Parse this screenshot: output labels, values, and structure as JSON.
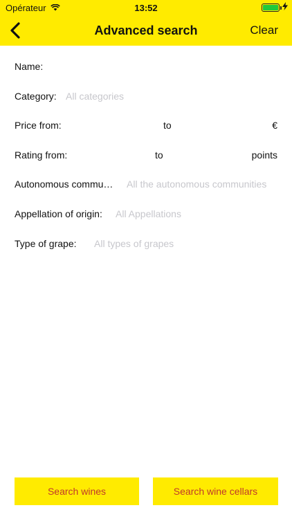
{
  "status": {
    "carrier": "Opérateur",
    "time": "13:52"
  },
  "nav": {
    "title": "Advanced search",
    "clear_label": "Clear"
  },
  "form": {
    "name": {
      "label": "Name:"
    },
    "category": {
      "label": "Category:",
      "placeholder": "All categories"
    },
    "price": {
      "label": "Price from:",
      "to_label": "to",
      "unit": "€"
    },
    "rating": {
      "label": "Rating from:",
      "to_label": "to",
      "unit": "points"
    },
    "autonomous": {
      "label": "Autonomous commu…",
      "placeholder": "All the autonomous communities"
    },
    "appellation": {
      "label": "Appellation of origin:",
      "placeholder": "All Appellations"
    },
    "grape": {
      "label": "Type of grape:",
      "placeholder": "All types of grapes"
    }
  },
  "buttons": {
    "search_wines": "Search wines",
    "search_cellars": "Search wine cellars"
  },
  "colors": {
    "accent": "#FFEB00",
    "button_text": "#C0392B",
    "placeholder": "#C7C7CC"
  }
}
